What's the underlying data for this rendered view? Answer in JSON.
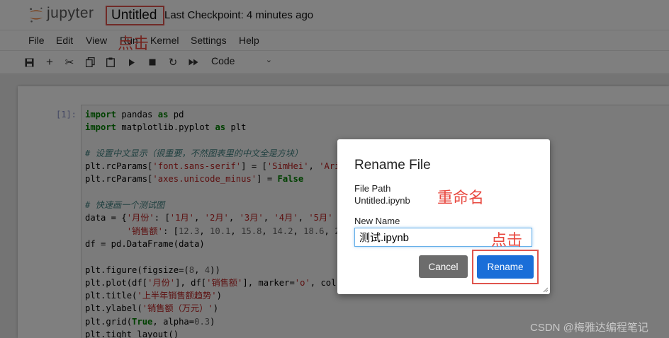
{
  "header": {
    "logo_text": "jupyter",
    "notebook_title": "Untitled",
    "checkpoint": "Last Checkpoint: 4 minutes ago"
  },
  "menu": [
    "File",
    "Edit",
    "View",
    "Run",
    "Kernel",
    "Settings",
    "Help"
  ],
  "toolbar": {
    "icons": [
      "save-icon",
      "add-cell-icon",
      "cut-icon",
      "copy-icon",
      "paste-icon",
      "run-icon",
      "stop-icon",
      "restart-icon",
      "fast-forward-icon"
    ],
    "cell_type": "Code"
  },
  "cell": {
    "prompt": "[1]:"
  },
  "code_lines": [
    "import pandas as pd",
    "import matplotlib.pyplot as plt",
    "",
    "# 设置中文显示（很重要，不然图表里的中文全是方块）",
    "plt.rcParams['font.sans-serif'] = ['SimHei', 'Aria",
    "plt.rcParams['axes.unicode_minus'] = False",
    "",
    "# 快速画一个测试图",
    "data = {'月份': ['1月', '2月', '3月', '4月', '5月'",
    "        '销售额': [12.3, 10.1, 15.8, 14.2, 18.6, 2",
    "df = pd.DataFrame(data)",
    "",
    "plt.figure(figsize=(8, 4))",
    "plt.plot(df['月份'], df['销售额'], marker='o', col",
    "plt.title('上半年销售额趋势')",
    "plt.ylabel('销售额（万元）')",
    "plt.grid(True, alpha=0.3)",
    "plt.tight_layout()"
  ],
  "dialog": {
    "title": "Rename File",
    "file_path_label": "File Path",
    "file_path_value": "Untitled.ipynb",
    "new_name_label": "New Name",
    "new_name_value": "测试.ipynb",
    "cancel_label": "Cancel",
    "rename_label": "Rename"
  },
  "annotations": {
    "click_1": "点击",
    "rename_note": "重命名",
    "click_2": "点击"
  },
  "watermark": "CSDN @梅雅达编程笔记",
  "colors": {
    "annotation_red": "#e8483f",
    "rename_button": "#1a6ed8",
    "cancel_button": "#6c6c6c",
    "jupyter_orange": "#f37726"
  }
}
